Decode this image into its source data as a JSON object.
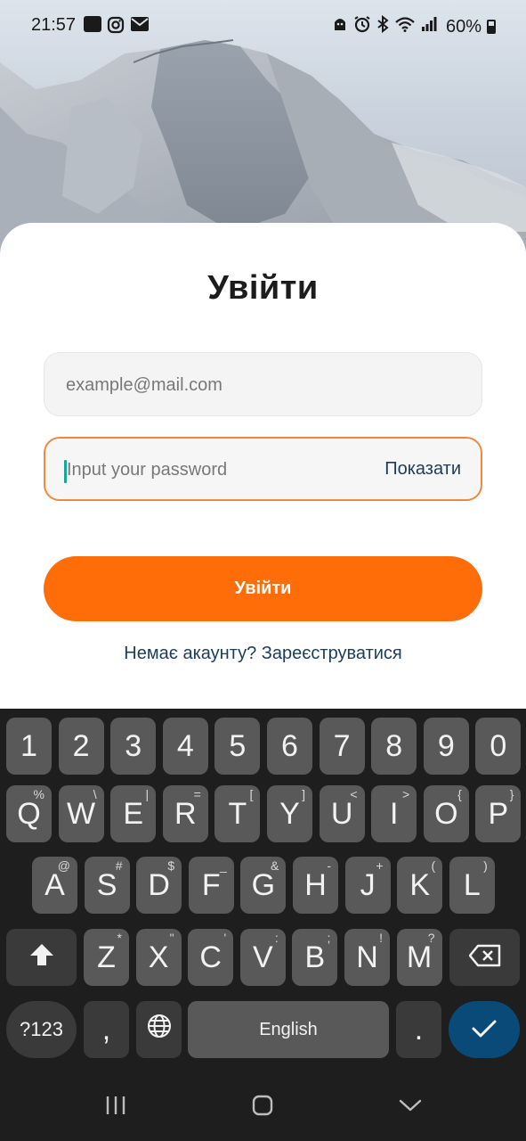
{
  "status_bar": {
    "time": "21:57",
    "battery": "60%",
    "left_icons": [
      "voicemail-icon",
      "instagram-icon",
      "mail-icon"
    ],
    "right_icons": [
      "android-icon",
      "alarm-icon",
      "bluetooth-icon",
      "wifi-icon",
      "signal-icon",
      "battery-icon"
    ]
  },
  "login": {
    "title": "Увійти",
    "email_placeholder": "example@mail.com",
    "email_value": "",
    "password_placeholder": "Input your password",
    "password_value": "",
    "show_label": "Показати",
    "submit_label": "Увійти",
    "register_text": "Немає акаунту? Зареєструватися"
  },
  "colors": {
    "accent": "#ff6d08",
    "focus_border": "#ee8a40",
    "link": "#1d3c57",
    "keyboard_bg": "#1e1e1e",
    "key_bg": "#595959",
    "enter_key": "#0a4a78"
  },
  "keyboard": {
    "row1": [
      {
        "k": "1"
      },
      {
        "k": "2"
      },
      {
        "k": "3"
      },
      {
        "k": "4"
      },
      {
        "k": "5"
      },
      {
        "k": "6"
      },
      {
        "k": "7"
      },
      {
        "k": "8"
      },
      {
        "k": "9"
      },
      {
        "k": "0"
      }
    ],
    "row2": [
      {
        "k": "Q",
        "a": "%"
      },
      {
        "k": "W",
        "a": "\\"
      },
      {
        "k": "E",
        "a": "|"
      },
      {
        "k": "R",
        "a": "="
      },
      {
        "k": "T",
        "a": "["
      },
      {
        "k": "Y",
        "a": "]"
      },
      {
        "k": "U",
        "a": "<"
      },
      {
        "k": "I",
        "a": ">"
      },
      {
        "k": "O",
        "a": "{"
      },
      {
        "k": "P",
        "a": "}"
      }
    ],
    "row3": [
      {
        "k": "A",
        "a": "@"
      },
      {
        "k": "S",
        "a": "#"
      },
      {
        "k": "D",
        "a": "$"
      },
      {
        "k": "F",
        "a": "_"
      },
      {
        "k": "G",
        "a": "&"
      },
      {
        "k": "H",
        "a": "-"
      },
      {
        "k": "J",
        "a": "+"
      },
      {
        "k": "K",
        "a": "("
      },
      {
        "k": "L",
        "a": ")"
      }
    ],
    "row4": [
      {
        "k": "Z",
        "a": "*"
      },
      {
        "k": "X",
        "a": "\""
      },
      {
        "k": "C",
        "a": "'"
      },
      {
        "k": "V",
        "a": ":"
      },
      {
        "k": "B",
        "a": ";"
      },
      {
        "k": "N",
        "a": "!"
      },
      {
        "k": "M",
        "a": "?"
      }
    ],
    "symbols_label": "?123",
    "comma": ",",
    "space_label": "English",
    "period": ".",
    "shift_icon": "shift-icon",
    "backspace_icon": "backspace-icon",
    "globe_icon": "globe-icon",
    "enter_icon": "checkmark-icon"
  },
  "nav_bar": {
    "buttons": [
      "recent-apps-icon",
      "home-icon",
      "back-icon"
    ]
  }
}
